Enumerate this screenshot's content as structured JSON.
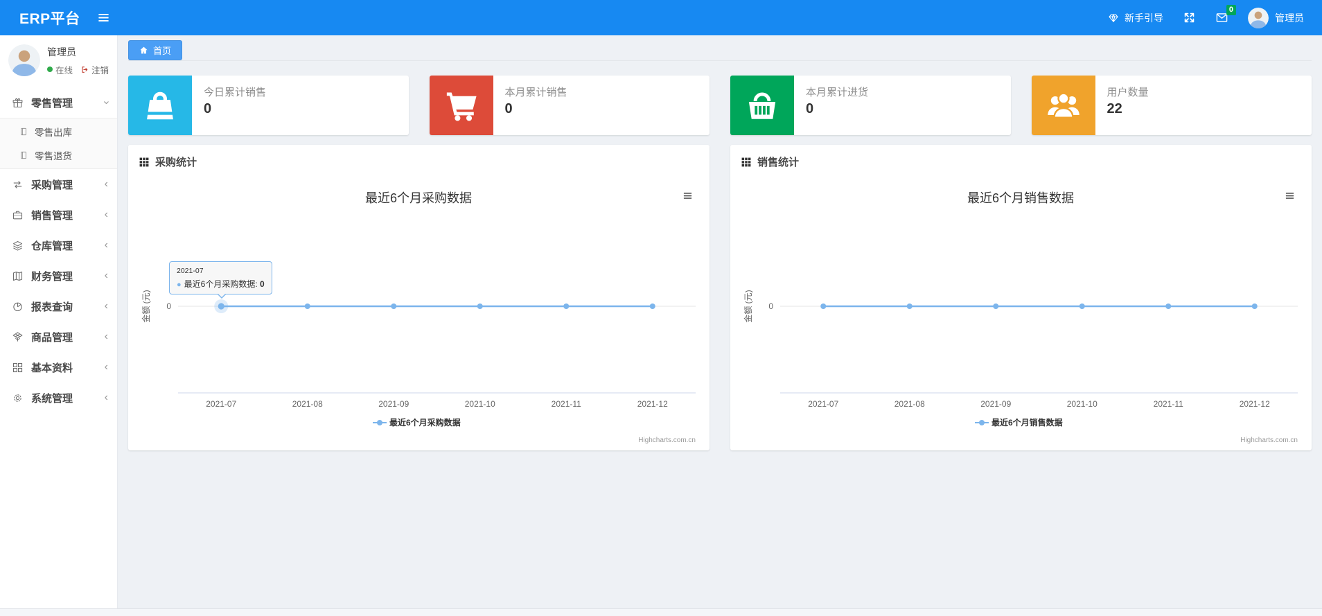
{
  "theme": {
    "navbar_color": "#1789f2",
    "tab_color": "#4a9ef5",
    "series_color": "#7cb5ec",
    "online_dot_color": "#2faa4a",
    "badge_color": "#00a65a"
  },
  "navbar": {
    "brand": "ERP平台",
    "guide": "新手引导",
    "mail_badge": "0",
    "username": "管理员"
  },
  "sidebar": {
    "user": {
      "name": "管理员",
      "status": "在线",
      "logout": "注销"
    },
    "items": [
      {
        "id": "retail",
        "label": "零售管理",
        "icon": "gift-icon",
        "expanded": true,
        "children": [
          {
            "id": "retail-out",
            "label": "零售出库",
            "icon": "file-icon"
          },
          {
            "id": "retail-return",
            "label": "零售退货",
            "icon": "file-icon"
          }
        ]
      },
      {
        "id": "purchase",
        "label": "采购管理",
        "icon": "exchange-icon"
      },
      {
        "id": "sales",
        "label": "销售管理",
        "icon": "briefcase-icon"
      },
      {
        "id": "warehouse",
        "label": "仓库管理",
        "icon": "layers-icon"
      },
      {
        "id": "finance",
        "label": "财务管理",
        "icon": "book-icon"
      },
      {
        "id": "reports",
        "label": "报表查询",
        "icon": "pie-icon"
      },
      {
        "id": "goods",
        "label": "商品管理",
        "icon": "box-icon"
      },
      {
        "id": "basic",
        "label": "基本资料",
        "icon": "grid-icon"
      },
      {
        "id": "system",
        "label": "系统管理",
        "icon": "gear-icon"
      }
    ]
  },
  "tabs": [
    {
      "label": "首页",
      "icon": "home-icon",
      "active": true
    }
  ],
  "stat_cards": [
    {
      "label": "今日累计销售",
      "value": "0",
      "color": "#26b8e7",
      "icon": "bag-icon"
    },
    {
      "label": "本月累计销售",
      "value": "0",
      "color": "#dd4b39",
      "icon": "cart-icon"
    },
    {
      "label": "本月累计进货",
      "value": "0",
      "color": "#00a65a",
      "icon": "basket-icon"
    },
    {
      "label": "用户数量",
      "value": "22",
      "color": "#f0a32c",
      "icon": "users-icon"
    }
  ],
  "panels": [
    {
      "header": "采购统计"
    },
    {
      "header": "销售统计"
    }
  ],
  "chart_data": [
    {
      "type": "line",
      "title": "最近6个月采购数据",
      "categories": [
        "2021-07",
        "2021-08",
        "2021-09",
        "2021-10",
        "2021-11",
        "2021-12"
      ],
      "series": [
        {
          "name": "最近6个月采购数据",
          "values": [
            0,
            0,
            0,
            0,
            0,
            0
          ],
          "color": "#7cb5ec"
        }
      ],
      "ylabel": "金额 (元)",
      "yticks": [
        "0"
      ],
      "ylim": [
        0,
        1
      ],
      "grid": true,
      "legend_position": "bottom",
      "credits": "Highcharts.com.cn",
      "tooltip": {
        "visible": true,
        "point_index": 0,
        "header": "2021-07",
        "series": "最近6个月采购数据",
        "value": "0"
      }
    },
    {
      "type": "line",
      "title": "最近6个月销售数据",
      "categories": [
        "2021-07",
        "2021-08",
        "2021-09",
        "2021-10",
        "2021-11",
        "2021-12"
      ],
      "series": [
        {
          "name": "最近6个月销售数据",
          "values": [
            0,
            0,
            0,
            0,
            0,
            0
          ],
          "color": "#7cb5ec"
        }
      ],
      "ylabel": "金额 (元)",
      "yticks": [
        "0"
      ],
      "ylim": [
        0,
        1
      ],
      "grid": true,
      "legend_position": "bottom",
      "credits": "Highcharts.com.cn",
      "tooltip": {
        "visible": false
      }
    }
  ]
}
